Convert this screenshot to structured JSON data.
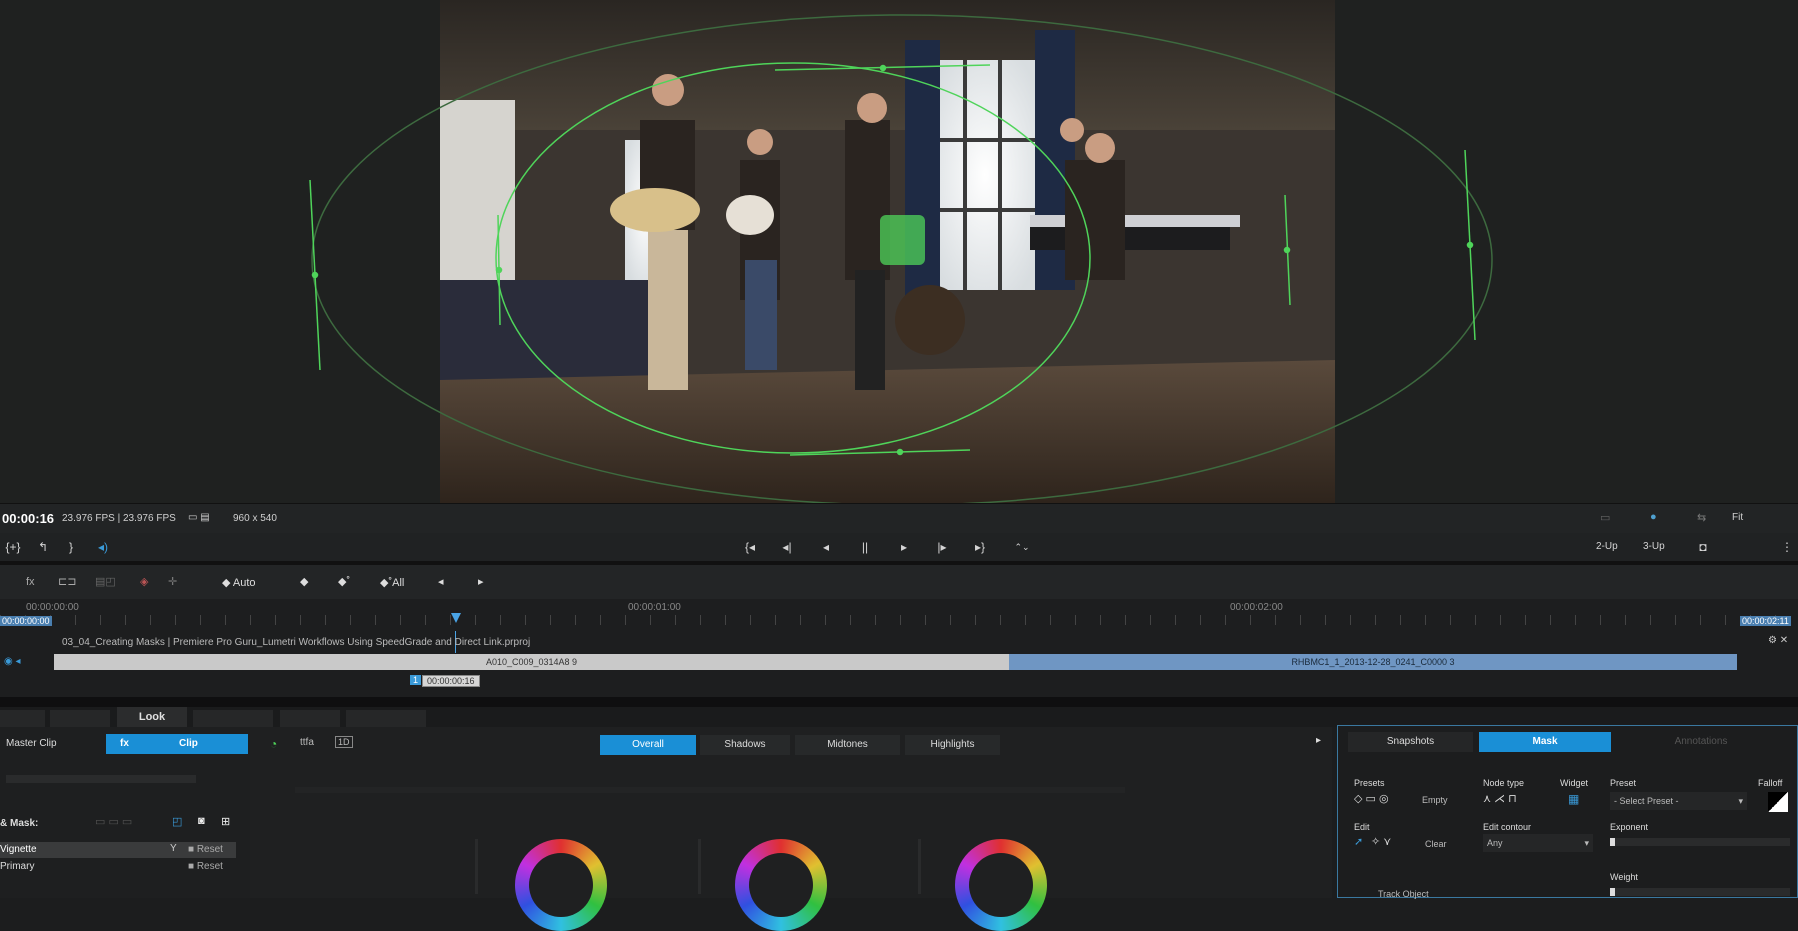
{
  "viewer": {
    "timecode": "00:00:16",
    "fps_text": "23.976 FPS | 23.976 FPS",
    "resolution": "960 x 540",
    "fit_label": "Fit"
  },
  "transport": {
    "left_icons": [
      "{+}",
      "↰",
      "}",
      "◂)"
    ],
    "controls": [
      "{◂",
      "◂|",
      "◂",
      "||",
      "▸",
      "|▸",
      "▸}",
      "⌃⌄"
    ],
    "layout_2up": "2-Up",
    "layout_3up": "3-Up"
  },
  "timeline_tools": {
    "auto": "Auto",
    "all": "All",
    "icons": [
      "fx",
      "⊏⊐"
    ]
  },
  "ruler": {
    "start": "00:00:00:00",
    "mark1": "00:00:01:00",
    "mark2": "00:00:02:00",
    "current": "00:00:00:00",
    "end": "00:00:02:11"
  },
  "tracks": {
    "project_title": "03_04_Creating Masks | Premiere Pro Guru_Lumetri Workflows Using SpeedGrade and Direct Link.prproj",
    "clip_a": "A010_C009_0314A8 9",
    "clip_b": "RHBMC1_1_2013-12-28_0241_C0000 3",
    "playhead_tc": "00:00:00:16",
    "track_badge": "1"
  },
  "module_tabs": {
    "items": [
      "Look"
    ],
    "active": "Look"
  },
  "left_panel": {
    "master_clip": "Master Clip",
    "clip": "Clip",
    "mask_label": "& Mask:",
    "layers": [
      {
        "name": "Vignette",
        "reset": "Reset"
      },
      {
        "name": "Primary",
        "reset": "Reset"
      }
    ]
  },
  "center_panel": {
    "tabs": [
      "Overall",
      "Shadows",
      "Midtones",
      "Highlights"
    ],
    "active_tab": "Overall",
    "icon_labels": [
      "ttfa",
      "1D"
    ]
  },
  "right_panel": {
    "tabs": [
      "Snapshots",
      "Mask",
      "Annotations"
    ],
    "active_tab": "Mask",
    "presets_label": "Presets",
    "empty": "Empty",
    "node_type": "Node type",
    "widget": "Widget",
    "preset": "Preset",
    "preset_value": "- Select Preset -",
    "falloff": "Falloff",
    "edit": "Edit",
    "clear": "Clear",
    "edit_contour": "Edit contour",
    "contour_value": "Any",
    "exponent": "Exponent",
    "weight": "Weight",
    "track_object": "Track Object"
  },
  "colors": {
    "accent": "#1a8fd6",
    "mask_green": "#4fd45a",
    "clip_a": "#c9c9c9",
    "clip_b": "#6f96c3"
  }
}
